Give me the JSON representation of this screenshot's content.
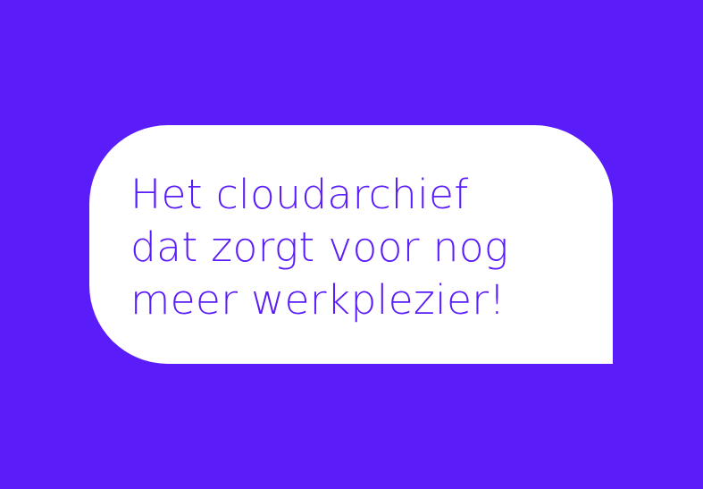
{
  "colors": {
    "background": "#5A1CF9",
    "bubble": "#FFFFFF",
    "text": "#5A1CF9"
  },
  "message": {
    "lines": [
      "Het cloudarchief",
      "dat zorgt voor nog",
      "meer werkplezier!"
    ]
  }
}
